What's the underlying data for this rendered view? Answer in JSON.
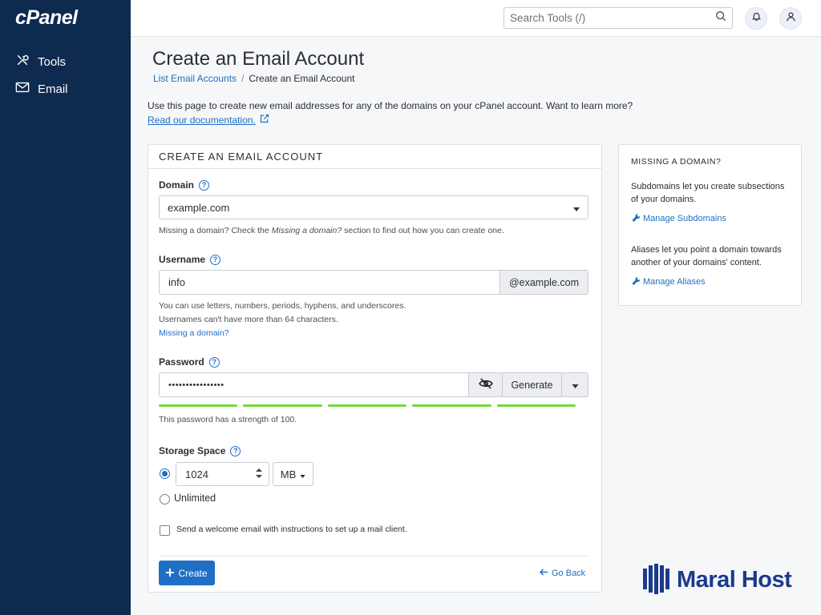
{
  "sidebar": {
    "logo": "cPanel",
    "items": [
      {
        "label": "Tools",
        "icon": "tools-icon"
      },
      {
        "label": "Email",
        "icon": "envelope-icon"
      }
    ]
  },
  "topbar": {
    "search_placeholder": "Search Tools (/)"
  },
  "page": {
    "title": "Create an Email Account",
    "breadcrumb": {
      "parent": "List Email Accounts",
      "current": "Create an Email Account"
    },
    "intro": "Use this page to create new email addresses for any of the domains on your cPanel account. Want to learn more?",
    "doc_link": "Read our documentation."
  },
  "form": {
    "header": "CREATE AN EMAIL ACCOUNT",
    "domain": {
      "label": "Domain",
      "value": "example.com",
      "help_prefix": "Missing a domain? Check the ",
      "help_em": "Missing a domain?",
      "help_suffix": " section to find out how you can create one."
    },
    "username": {
      "label": "Username",
      "value": "info",
      "suffix": "@example.com",
      "help1": "You can use letters, numbers, periods, hyphens, and underscores.",
      "help2": "Usernames can't have more than 64 characters.",
      "missing_link": "Missing a domain?"
    },
    "password": {
      "label": "Password",
      "value": "••••••••••••••••",
      "generate": "Generate",
      "strength_text": "This password has a strength of 100.",
      "strength": 100
    },
    "storage": {
      "label": "Storage Space",
      "value": "1024",
      "unit": "MB",
      "unlimited": "Unlimited"
    },
    "welcome": "Send a welcome email with instructions to set up a mail client.",
    "create_label": "Create",
    "goback_label": "Go Back"
  },
  "side": {
    "title": "MISSING A DOMAIN?",
    "text1": "Subdomains let you create subsections of your domains.",
    "link1": "Manage Subdomains",
    "text2": "Aliases let you point a domain towards another of your domains' content.",
    "link2": "Manage Aliases"
  },
  "brand": {
    "name": "Maral Host"
  },
  "colors": {
    "sidebar": "#0f2a4f",
    "accent": "#1f6fc5",
    "strength": "#6fdc3a"
  }
}
